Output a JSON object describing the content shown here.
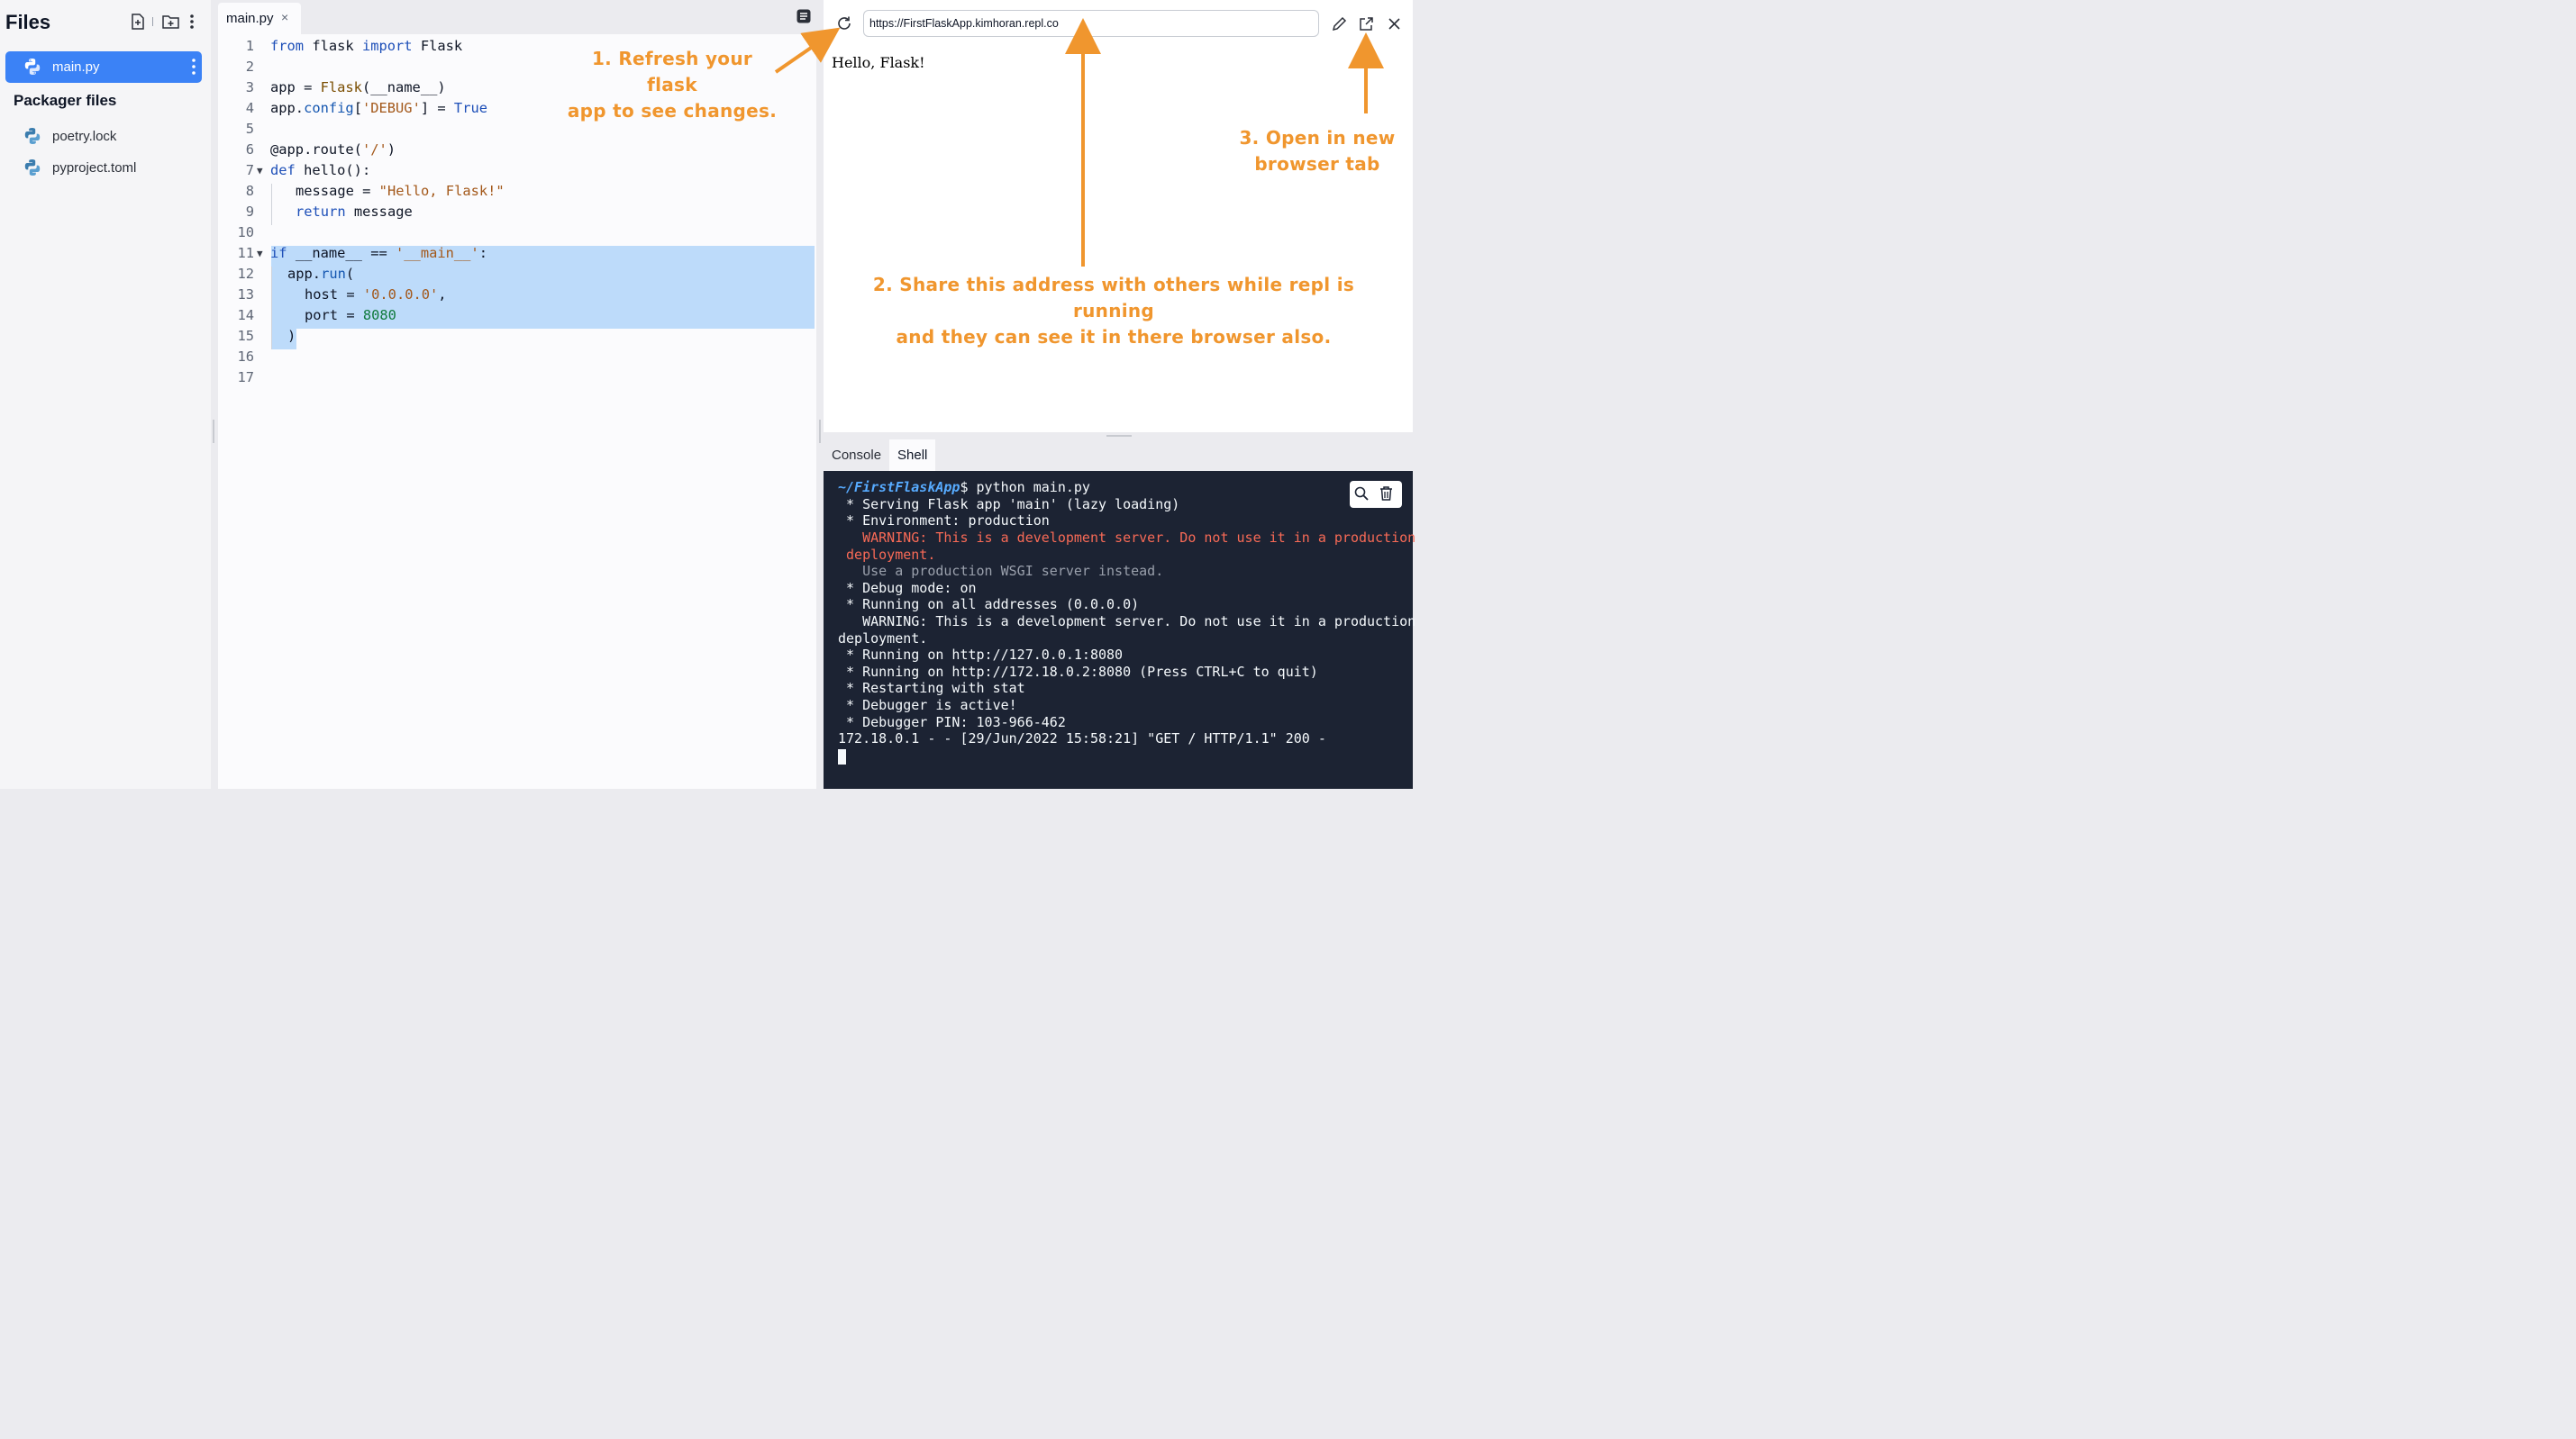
{
  "sidebar": {
    "title": "Files",
    "active_file": "main.py",
    "section_title": "Packager files",
    "packager_files": [
      "poetry.lock",
      "pyproject.toml"
    ]
  },
  "editor": {
    "tab_label": "main.py",
    "tab_close": "×",
    "line_numbers": [
      "1",
      "2",
      "3",
      "4",
      "5",
      "6",
      "7",
      "8",
      "9",
      "10",
      "11",
      "12",
      "13",
      "14",
      "15",
      "16",
      "17"
    ],
    "code": {
      "l1": {
        "kw1": "from",
        "mod": " flask ",
        "kw2": "import",
        "rest": " Flask"
      },
      "l3": {
        "a": "app = ",
        "cls": "Flask",
        "b": "(__name__)"
      },
      "l4": {
        "a": "app.",
        "fn": "config",
        "b": "[",
        "str": "'DEBUG'",
        "c": "] = ",
        "val": "True"
      },
      "l6": {
        "a": "@app.route(",
        "str": "'/'",
        "b": ")"
      },
      "l7": {
        "kw": "def",
        "rest": " hello():"
      },
      "l8": {
        "a": "message = ",
        "str": "\"Hello, Flask!\""
      },
      "l9": {
        "kw": "return",
        "rest": " message"
      },
      "l11": {
        "kw": "if",
        "a": " __name__ == ",
        "str": "'__main__'",
        "b": ":"
      },
      "l12": {
        "a": "app.",
        "fn": "run",
        "b": "("
      },
      "l13": {
        "a": "host = ",
        "str": "'0.0.0.0'",
        "b": ","
      },
      "l14": {
        "a": "port = ",
        "num": "8080"
      },
      "l15": {
        "a": ")"
      }
    }
  },
  "webview": {
    "url": "https://FirstFlaskApp.kimhoran.repl.co",
    "page_text": "Hello, Flask!"
  },
  "annotations": {
    "a1_line1": "1. Refresh your flask",
    "a1_line2": "app to see changes.",
    "a2_line1": "2. Share this address with others while repl is running",
    "a2_line2": "and they can see it in there browser also.",
    "a3_line1": "3. Open in new",
    "a3_line2": "browser tab",
    "color": "#f0962e"
  },
  "panel": {
    "tabs": [
      "Console",
      "Shell"
    ],
    "active_tab": "Shell"
  },
  "terminal": {
    "prompt_path": "~/FirstFlaskApp",
    "prompt_cmd": "$ python main.py",
    "lines": [
      " * Serving Flask app 'main' (lazy loading)",
      " * Environment: production",
      "   WARNING: This is a development server. Do not use it in a production",
      " deployment.",
      "   Use a production WSGI server instead.",
      " * Debug mode: on",
      " * Running on all addresses (0.0.0.0)",
      "   WARNING: This is a development server. Do not use it in a production",
      "deployment.",
      " * Running on http://127.0.0.1:8080",
      " * Running on http://172.18.0.2:8080 (Press CTRL+C to quit)",
      " * Restarting with stat",
      " * Debugger is active!",
      " * Debugger PIN: 103-966-462",
      "172.18.0.1 - - [29/Jun/2022 15:58:21] \"GET / HTTP/1.1\" 200 -"
    ]
  }
}
